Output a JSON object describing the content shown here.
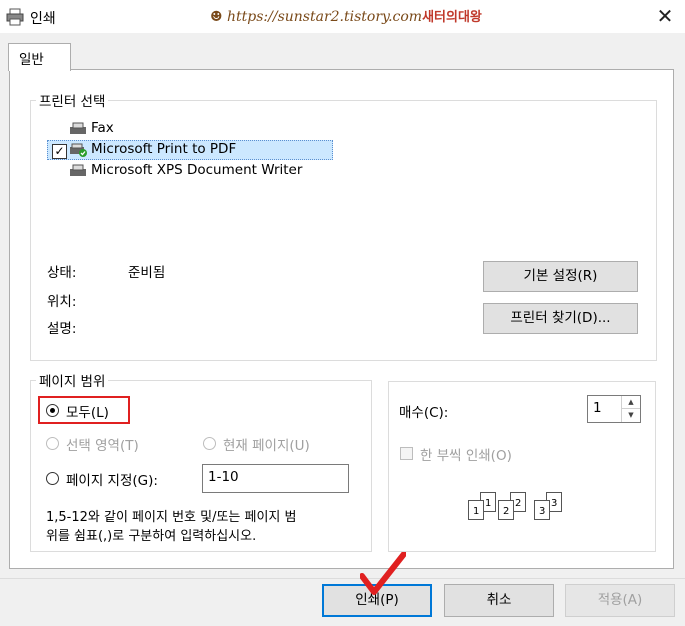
{
  "window": {
    "title": "인쇄",
    "watermark_url": "https://sunstar2.tistory.com",
    "watermark_tag": "새터의대왕"
  },
  "tabs": [
    {
      "label": "일반"
    }
  ],
  "printer_group": {
    "legend": "프린터 선택",
    "printers": [
      {
        "name": "Fax"
      },
      {
        "name": "Microsoft Print to PDF",
        "selected": true
      },
      {
        "name": "Microsoft XPS Document Writer"
      }
    ],
    "status_label": "상태:",
    "status_value": "준비됨",
    "location_label": "위치:",
    "comment_label": "설명:",
    "preferences_button": "기본 설정(R)",
    "find_printer_button": "프린터 찾기(D)..."
  },
  "page_range": {
    "legend": "페이지 범위",
    "all_label": "모두(L)",
    "selection_label": "선택 영역(T)",
    "current_page_label": "현재 페이지(U)",
    "pages_label": "페이지 지정(G):",
    "pages_value": "1-10",
    "hint_line1": "1,5-12와 같이 페이지 번호 및/또는 페이지 범",
    "hint_line2": "위를 쉼표(,)로 구분하여 입력하십시오."
  },
  "copies": {
    "label": "매수(C):",
    "value": "1",
    "collate_label": "한 부씩 인쇄(O)",
    "collate_pages": [
      "1",
      "1",
      "2",
      "2",
      "3",
      "3"
    ]
  },
  "buttons": {
    "print": "인쇄(P)",
    "cancel": "취소",
    "apply": "적용(A)"
  },
  "colors": {
    "accent": "#0078d7",
    "highlight": "#e02020",
    "selection": "#cce8ff"
  }
}
